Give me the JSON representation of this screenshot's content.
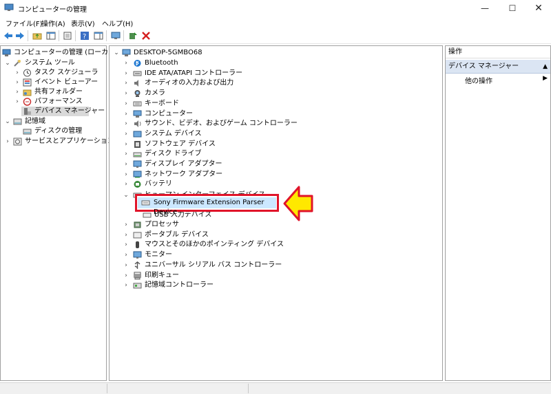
{
  "window": {
    "title": "コンピューターの管理",
    "controls": [
      "—",
      "☐",
      "✕"
    ]
  },
  "menu": [
    "ファイル(F)",
    "操作(A)",
    "表示(V)",
    "ヘルプ(H)"
  ],
  "left_tree": {
    "root": "コンピューターの管理 (ローカル)",
    "system_tools": "システム ツール",
    "items": [
      "タスク スケジューラ",
      "イベント ビューアー",
      "共有フォルダー",
      "パフォーマンス",
      "デバイス マネージャー"
    ],
    "storage": "記憶域",
    "disk_mgmt": "ディスクの管理",
    "services": "サービスとアプリケーション"
  },
  "device_tree": {
    "computer": "DESKTOP-5GMBO68",
    "categories": [
      "Bluetooth",
      "IDE ATA/ATAPI コントローラー",
      "オーディオの入力および出力",
      "カメラ",
      "キーボード",
      "コンピューター",
      "サウンド、ビデオ、およびゲーム コントローラー",
      "システム デバイス",
      "ソフトウェア デバイス",
      "ディスク ドライブ",
      "ディスプレイ アダプター",
      "ネットワーク アダプター",
      "バッテリ",
      "ヒューマン インターフェイス デバイス"
    ],
    "hid_children": [
      "Sony Firmware Extension Parser Device",
      "USB 入力デバイス"
    ],
    "categories_after": [
      "プロセッサ",
      "ポータブル デバイス",
      "マウスとそのほかのポインティング デバイス",
      "モニター",
      "ユニバーサル シリアル バス コントローラー",
      "印刷キュー",
      "記憶域コントローラー"
    ]
  },
  "actions_pane": {
    "header": "操作",
    "section": "デバイス マネージャー",
    "item": "他の操作"
  },
  "colors": {
    "highlight_border": "#e0142a",
    "arrow_fill": "#ffe800",
    "arrow_stroke": "#e0142a",
    "selection": "#cce8ff"
  }
}
